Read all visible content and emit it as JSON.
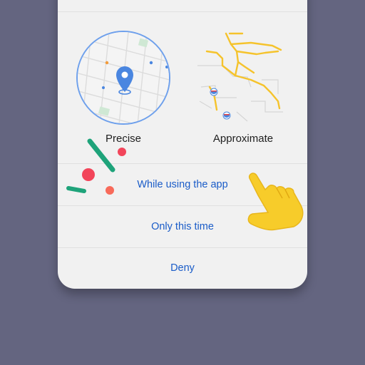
{
  "permission_dialog": {
    "precision_options": [
      {
        "label": "Precise"
      },
      {
        "label": "Approximate"
      }
    ],
    "choices": [
      {
        "label": "While using the app"
      },
      {
        "label": "Only this time"
      },
      {
        "label": "Deny"
      }
    ]
  },
  "colors": {
    "background": "#646580",
    "sheet": "#f1f1f1",
    "accent_blue": "#1a5cc8",
    "circle_border": "#6ea0ec",
    "pin": "#4a86e0",
    "road_yellow": "#f5c32c",
    "hand_yellow": "#f7cc2a",
    "confetti_green": "#1ea37a",
    "confetti_red": "#f2455a"
  },
  "icons": [
    "location-pin-icon",
    "pointing-hand-icon"
  ]
}
